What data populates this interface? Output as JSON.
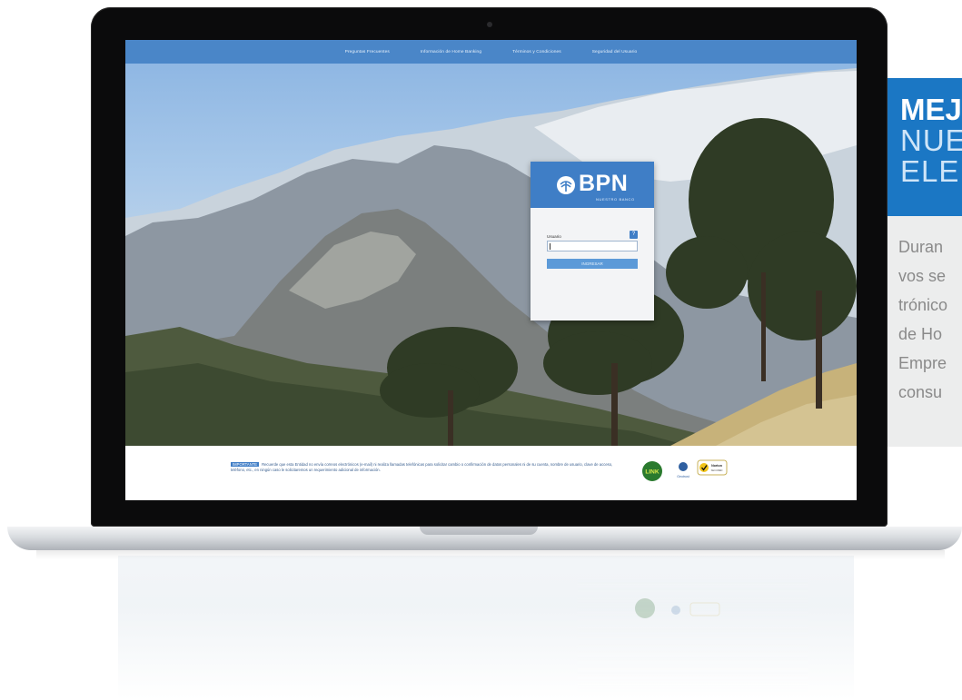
{
  "nav": {
    "items": [
      "Preguntas Frecuentes",
      "Información de Home Banking",
      "Términos y Condiciones",
      "Seguridad del Usuario"
    ]
  },
  "login": {
    "logo_text": "BPN",
    "logo_subtitle": "NUESTRO BANCO",
    "user_label": "Usuario",
    "help_label": "?",
    "submit_label": "INGRESAR"
  },
  "footer": {
    "notice_tag": "IMPORTANTE",
    "notice_text": "Recuerde que esta Entidad no envía correos electrónicos (e-mail) ni realiza llamadas telefónicas para solicitar cambio o confirmación de datos personales ni de su cuenta, nombre de usuario, clave de acceso, teléfono, etc., en ningún caso le solicitaremos un requerimiento adicional de información.",
    "badges": [
      "LINK",
      "Geotrust",
      "Norton SECURED"
    ]
  },
  "promo": {
    "title_line1": "MEJ",
    "title_line2": "NUE",
    "title_line3": "ELE",
    "body_lines": [
      "Duran",
      "vos se",
      "trónico",
      "de Ho",
      "Empre",
      "consu"
    ]
  },
  "colors": {
    "brand_blue": "#3f7ec6",
    "nav_blue": "#4a86c8",
    "promo_blue": "#1b77c4"
  }
}
